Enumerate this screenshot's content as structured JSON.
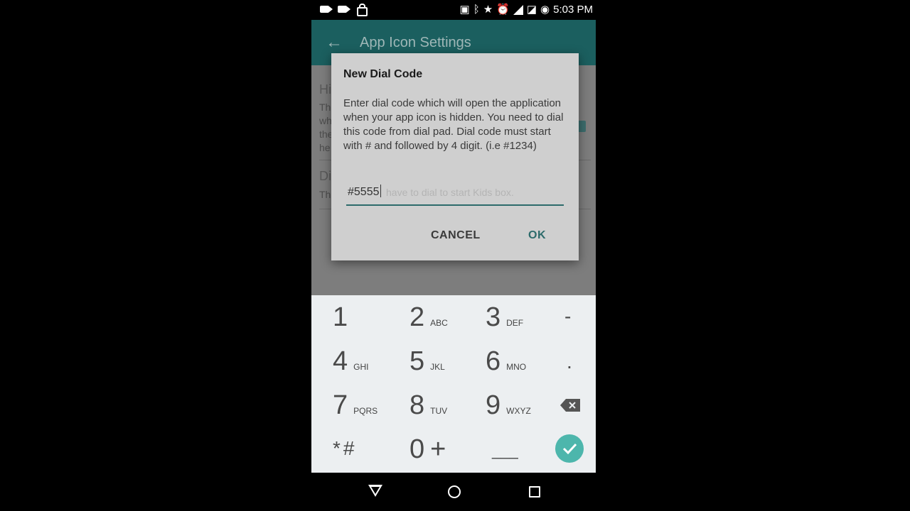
{
  "status_bar": {
    "time": "5:03 PM"
  },
  "app_bar": {
    "title": "App Icon Settings"
  },
  "settings": {
    "hide_icon": {
      "title": "Hide Icon",
      "summary_lines": [
        "The",
        "wh",
        "the",
        "he"
      ]
    },
    "dial_code": {
      "title": "Dial Code",
      "summary": "The"
    }
  },
  "dialog": {
    "title": "New Dial Code",
    "message": "Enter dial code which will open the application when your app icon is hidden. You need to dial this code from dial pad. Dial code must start with # and followed by 4 digit. (i.e #1234)",
    "input_value": "#5555",
    "background_hint": "have to dial to start Kids box.",
    "cancel_label": "CANCEL",
    "ok_label": "OK"
  },
  "keypad": {
    "keys": [
      {
        "digit": "1",
        "letters": ""
      },
      {
        "digit": "2",
        "letters": "ABC"
      },
      {
        "digit": "3",
        "letters": "DEF"
      },
      {
        "digit": "4",
        "letters": "GHI"
      },
      {
        "digit": "5",
        "letters": "JKL"
      },
      {
        "digit": "6",
        "letters": "MNO"
      },
      {
        "digit": "7",
        "letters": "PQRS"
      },
      {
        "digit": "8",
        "letters": "TUV"
      },
      {
        "digit": "9",
        "letters": "WXYZ"
      },
      {
        "digit": "0",
        "letters": "+"
      }
    ],
    "minus": "-",
    "period": ".",
    "star_hash": "*#",
    "space": "___"
  },
  "colors": {
    "accent": "#4db6ac",
    "app_bar": "#1b5f5f",
    "dialog_button": "#2d6b6b"
  },
  "icons": {
    "status_left": [
      "video-camera-icon",
      "video-camera-icon",
      "lock-icon"
    ],
    "status_right": [
      "cast-icon",
      "bluetooth-icon",
      "star-icon",
      "alarm-icon",
      "signal-icon",
      "no-sim-icon",
      "data-saver-icon"
    ],
    "nav": [
      "back-icon",
      "home-icon",
      "recents-icon"
    ]
  }
}
